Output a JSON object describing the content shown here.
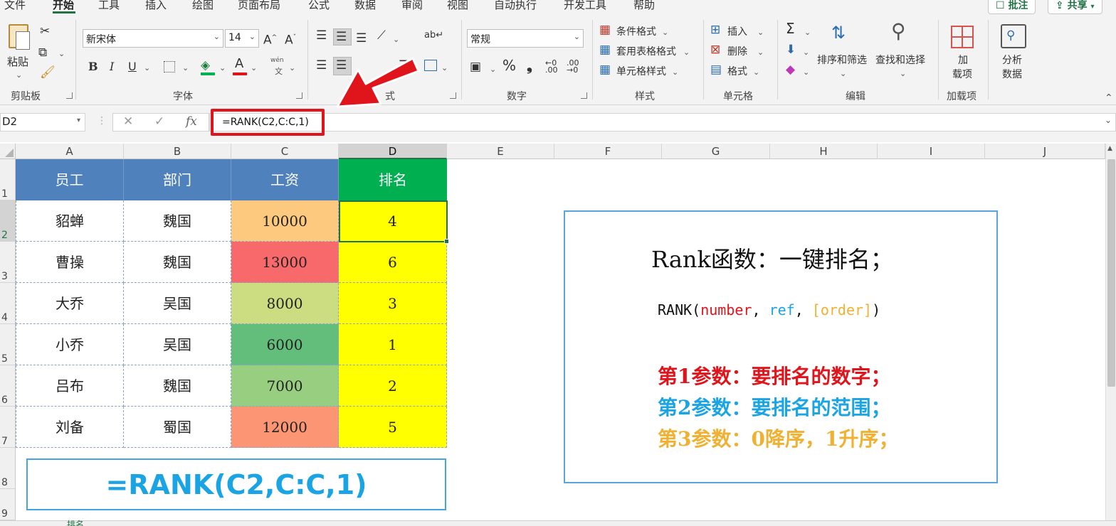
{
  "menu": {
    "items": [
      "文件",
      "开始",
      "工具",
      "插入",
      "绘图",
      "页面布局",
      "公式",
      "数据",
      "审阅",
      "视图",
      "自动执行",
      "开发工具",
      "帮助"
    ],
    "active": "开始",
    "comment_label": "批注",
    "share_label": "共享"
  },
  "ribbon": {
    "clipboard": {
      "paste_label": "粘贴",
      "group_label": "剪贴板"
    },
    "font": {
      "name": "新宋体",
      "size": "14",
      "group_label": "字体",
      "bold": "B",
      "italic": "I",
      "underline": "U",
      "wen": "wén",
      "wen_char": "文"
    },
    "alignment": {
      "group_label": "对齐方式",
      "visible_label": "式"
    },
    "number": {
      "format": "常规",
      "group_label": "数字"
    },
    "styles": {
      "cond_format": "条件格式",
      "table_format": "套用表格格式",
      "cell_style": "单元格样式",
      "group_label": "样式"
    },
    "cells": {
      "insert": "插入",
      "delete": "删除",
      "format": "格式",
      "group_label": "单元格"
    },
    "editing": {
      "sort_filter": "排序和筛选",
      "find_select": "查找和选择",
      "group_label": "编辑"
    },
    "addins": {
      "label_line1": "加",
      "label_line2": "载项",
      "group_label": "加载项"
    },
    "analysis": {
      "label_line1": "分析",
      "label_line2": "数据"
    }
  },
  "formula_bar": {
    "name_box": "D2",
    "formula": "=RANK(C2,C:C,1)"
  },
  "columns": [
    "A",
    "B",
    "C",
    "D",
    "E",
    "F",
    "G",
    "H",
    "I",
    "J"
  ],
  "rows": [
    "1",
    "2",
    "3",
    "4",
    "5",
    "6",
    "7",
    "8",
    "9"
  ],
  "table": {
    "headers": [
      "员工",
      "部门",
      "工资",
      "排名"
    ],
    "rows": [
      {
        "name": "貂蝉",
        "dept": "魏国",
        "salary": "10000",
        "rank": "4",
        "salary_color": "#fdc97f"
      },
      {
        "name": "曹操",
        "dept": "魏国",
        "salary": "13000",
        "rank": "6",
        "salary_color": "#f8696b"
      },
      {
        "name": "大乔",
        "dept": "吴国",
        "salary": "8000",
        "rank": "3",
        "salary_color": "#cbdc81"
      },
      {
        "name": "小乔",
        "dept": "吴国",
        "salary": "6000",
        "rank": "1",
        "salary_color": "#63be7b"
      },
      {
        "name": "吕布",
        "dept": "魏国",
        "salary": "7000",
        "rank": "2",
        "salary_color": "#98ce7f"
      },
      {
        "name": "刘备",
        "dept": "蜀国",
        "salary": "12000",
        "rank": "5",
        "salary_color": "#fb9574"
      }
    ]
  },
  "formula_display": "=RANK(C2,C:C,1)",
  "info": {
    "title": "Rank函数：一键排名；",
    "syntax_fn": "RANK(",
    "syntax_number": "number",
    "syntax_sep1": ", ",
    "syntax_ref": "ref",
    "syntax_sep2": ", ",
    "syntax_order": "[order]",
    "syntax_close": ")",
    "line1": "第1参数：要排名的数字；",
    "line2": "第2参数：要排名的范围；",
    "line3": "第3参数：0降序，1升序；"
  },
  "colors": {
    "header_blue": "#4f81bd",
    "header_green": "#00b050",
    "rank_yellow": "#ffff00",
    "accent_green": "#217346",
    "red": "#e0141b",
    "blue": "#1ba4e3",
    "gold": "#f0b132"
  },
  "sheet_tab": "排名"
}
